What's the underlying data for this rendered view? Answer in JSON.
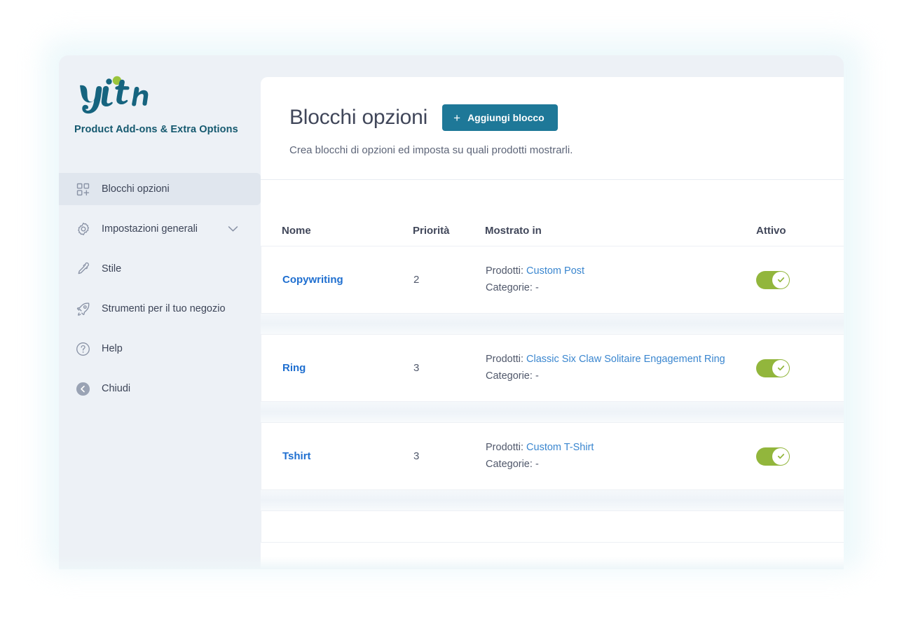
{
  "brand": {
    "logo_text": "yith",
    "logo_teal": "#16647f",
    "logo_green": "#9ac43c",
    "plugin_name": "Product Add-ons & Extra Options"
  },
  "sidebar": {
    "items": [
      {
        "label": "Blocchi opzioni",
        "icon": "blocks-add-icon",
        "active": true,
        "has_chevron": false
      },
      {
        "label": "Impostazioni generali",
        "icon": "gear-icon",
        "active": false,
        "has_chevron": true
      },
      {
        "label": "Stile",
        "icon": "eyedropper-icon",
        "active": false,
        "has_chevron": false
      },
      {
        "label": "Strumenti per il tuo negozio",
        "icon": "rocket-icon",
        "active": false,
        "has_chevron": false
      },
      {
        "label": "Help",
        "icon": "question-circle-icon",
        "active": false,
        "has_chevron": false
      },
      {
        "label": "Chiudi",
        "icon": "back-arrow-icon",
        "active": false,
        "has_chevron": false
      }
    ]
  },
  "header": {
    "title": "Blocchi opzioni",
    "add_button_label": "Aggiungi blocco",
    "add_button_icon": "plus-icon",
    "add_button_color": "#1e7898",
    "subtitle": "Crea blocchi di opzioni ed imposta su quali prodotti mostrarli."
  },
  "table": {
    "columns": [
      "Nome",
      "Priorità",
      "Mostrato in",
      "Attivo"
    ],
    "labels": {
      "prodotti": "Prodotti:",
      "categorie": "Categorie:"
    },
    "toggle_on_color": "#92b63c",
    "rows": [
      {
        "name": "Copywriting",
        "priority": "2",
        "prodotti_value": "Custom Post",
        "categorie_value": "-",
        "active": true
      },
      {
        "name": "Ring",
        "priority": "3",
        "prodotti_value": "Classic Six Claw Solitaire Engagement Ring",
        "categorie_value": "-",
        "active": true
      },
      {
        "name": "Tshirt",
        "priority": "3",
        "prodotti_value": "Custom T-Shirt",
        "categorie_value": "-",
        "active": true
      }
    ]
  }
}
